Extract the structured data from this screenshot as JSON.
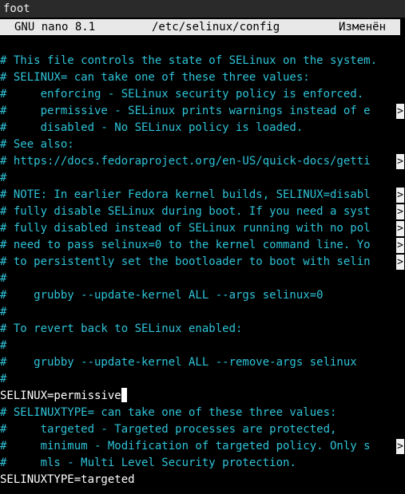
{
  "window": {
    "title": "foot"
  },
  "nano": {
    "version": "GNU nano 8.1",
    "path": "/etc/selinux/config",
    "status": "Изменён"
  },
  "overflow_marker": ">",
  "colors": {
    "comment": "#2ec3d8",
    "text": "#ffffff",
    "header_bg": "#e8e8e8",
    "background": "#000000"
  },
  "lines": [
    {
      "text": "# This file controls the state of SELinux on the system.",
      "comment": true,
      "overflow": false
    },
    {
      "text": "# SELINUX= can take one of these three values:",
      "comment": true,
      "overflow": false
    },
    {
      "text": "#     enforcing - SELinux security policy is enforced.",
      "comment": true,
      "overflow": false
    },
    {
      "text": "#     permissive - SELinux prints warnings instead of e",
      "comment": true,
      "overflow": true
    },
    {
      "text": "#     disabled - No SELinux policy is loaded.",
      "comment": true,
      "overflow": false
    },
    {
      "text": "# See also:",
      "comment": true,
      "overflow": false
    },
    {
      "text": "# https://docs.fedoraproject.org/en-US/quick-docs/getti",
      "comment": true,
      "overflow": true
    },
    {
      "text": "#",
      "comment": true,
      "overflow": false
    },
    {
      "text": "# NOTE: In earlier Fedora kernel builds, SELINUX=disabl",
      "comment": true,
      "overflow": true
    },
    {
      "text": "# fully disable SELinux during boot. If you need a syst",
      "comment": true,
      "overflow": true
    },
    {
      "text": "# fully disabled instead of SELinux running with no pol",
      "comment": true,
      "overflow": true
    },
    {
      "text": "# need to pass selinux=0 to the kernel command line. Yo",
      "comment": true,
      "overflow": true
    },
    {
      "text": "# to persistently set the bootloader to boot with selin",
      "comment": true,
      "overflow": true
    },
    {
      "text": "#",
      "comment": true,
      "overflow": false
    },
    {
      "text": "#    grubby --update-kernel ALL --args selinux=0",
      "comment": true,
      "overflow": false
    },
    {
      "text": "#",
      "comment": true,
      "overflow": false
    },
    {
      "text": "# To revert back to SELinux enabled:",
      "comment": true,
      "overflow": false
    },
    {
      "text": "#",
      "comment": true,
      "overflow": false
    },
    {
      "text": "#    grubby --update-kernel ALL --remove-args selinux",
      "comment": true,
      "overflow": false
    },
    {
      "text": "#",
      "comment": true,
      "overflow": false
    },
    {
      "text": "SELINUX=permissive",
      "comment": false,
      "overflow": false,
      "cursor": true
    },
    {
      "text": "# SELINUXTYPE= can take one of these three values:",
      "comment": true,
      "overflow": false
    },
    {
      "text": "#     targeted - Targeted processes are protected,",
      "comment": true,
      "overflow": false
    },
    {
      "text": "#     minimum - Modification of targeted policy. Only s",
      "comment": true,
      "overflow": true
    },
    {
      "text": "#     mls - Multi Level Security protection.",
      "comment": true,
      "overflow": false
    },
    {
      "text": "SELINUXTYPE=targeted",
      "comment": false,
      "overflow": false
    }
  ]
}
